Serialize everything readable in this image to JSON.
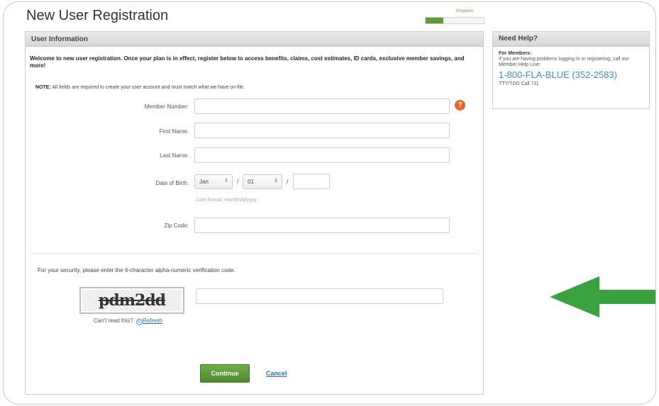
{
  "page": {
    "title": "New User Registration",
    "progress_label": "Progress:",
    "progress_fraction": 0.3
  },
  "form": {
    "header": "User Information",
    "welcome": "Welcome to new user registration. Once your plan is in effect, register below to access benefits, claims, cost estimates, ID cards, exclusive member savings, and more!",
    "note_label": "NOTE:",
    "note_text": "All fields are required to create your user account and must match what we have on file.",
    "member_number_label": "Member Number:",
    "member_number_value": "",
    "help_badge": "?",
    "first_name_label": "First Name:",
    "first_name_value": "",
    "last_name_label": "Last Name:",
    "last_name_value": "",
    "dob_label": "Date of Birth:",
    "dob_month": "Jan",
    "dob_day": "01",
    "dob_year": "",
    "dob_separator": "/",
    "select_arrow": "⇕",
    "date_format": "Date format: month/dd/yyyy",
    "zip_label": "Zip Code:",
    "zip_value": "",
    "security_text": "For your security, please enter the 6-character alpha-numeric verification code.",
    "captcha_text": "pdm2dd",
    "captcha_value": "",
    "cant_read": "Can't read this?",
    "refresh_label": "Refresh",
    "continue_label": "Continue",
    "cancel_label": "Cancel"
  },
  "help": {
    "header": "Need Help?",
    "for_members": "For Members:",
    "text": "If you are having problems logging in or registering, call our Member Help Line:",
    "phone": "1-800-FLA-BLUE (352-2583)",
    "tty": "TTY/TDD Call 711"
  },
  "colors": {
    "accent_green": "#5e9c3a",
    "arrow_green": "#3aa13f",
    "link_blue": "#2a6fb8",
    "phone_blue": "#3a8fd6",
    "help_badge_orange": "#e8642c"
  },
  "icons": {
    "help_badge": "question-circle-icon",
    "refresh": "refresh-icon",
    "annotation": "left-arrow-icon"
  }
}
